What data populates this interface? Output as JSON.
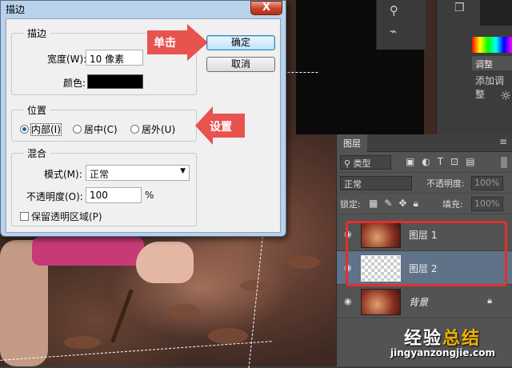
{
  "dialog": {
    "title": "描边",
    "close": "X",
    "stroke_group": {
      "title": "描边",
      "width_label": "宽度(W):",
      "width_value": "10 像素",
      "color_label": "颜色:",
      "color_value": "#000000"
    },
    "position_group": {
      "title": "位置",
      "options": [
        {
          "label": "内部(I)",
          "selected": true
        },
        {
          "label": "居中(C)",
          "selected": false
        },
        {
          "label": "居外(U)",
          "selected": false
        }
      ]
    },
    "blend_group": {
      "title": "混合",
      "mode_label": "模式(M):",
      "mode_value": "正常",
      "opacity_label": "不透明度(O):",
      "opacity_value": "100",
      "opacity_unit": "%",
      "preserve_label": "保留透明区域(P)",
      "preserve_checked": false
    },
    "buttons": {
      "ok": "确定",
      "cancel": "取消"
    }
  },
  "annotations": {
    "click": "单击",
    "settings": "设置",
    "accent": "#e8524f"
  },
  "right_panels": {
    "adjust_tab": "调整",
    "adjust_add": "添加调整"
  },
  "layers_panel": {
    "tab": "图层",
    "menu": "≡",
    "filter_select": "类型",
    "blend_mode": "正常",
    "opacity_label": "不透明度:",
    "opacity_value": "100%",
    "lock_label": "锁定:",
    "fill_label": "填充:",
    "fill_value": "100%",
    "layers": [
      {
        "name": "图层 1",
        "visible": true,
        "thumb": "photo",
        "selected": false
      },
      {
        "name": "图层 2",
        "visible": true,
        "thumb": "transparent",
        "selected": true
      },
      {
        "name": "背景",
        "visible": true,
        "thumb": "photo",
        "selected": false,
        "locked": true
      }
    ],
    "highlight_color": "#e0302e"
  },
  "watermark": {
    "text_a": "经验",
    "text_b": "总结",
    "url": "jingyanzongjie.com"
  }
}
